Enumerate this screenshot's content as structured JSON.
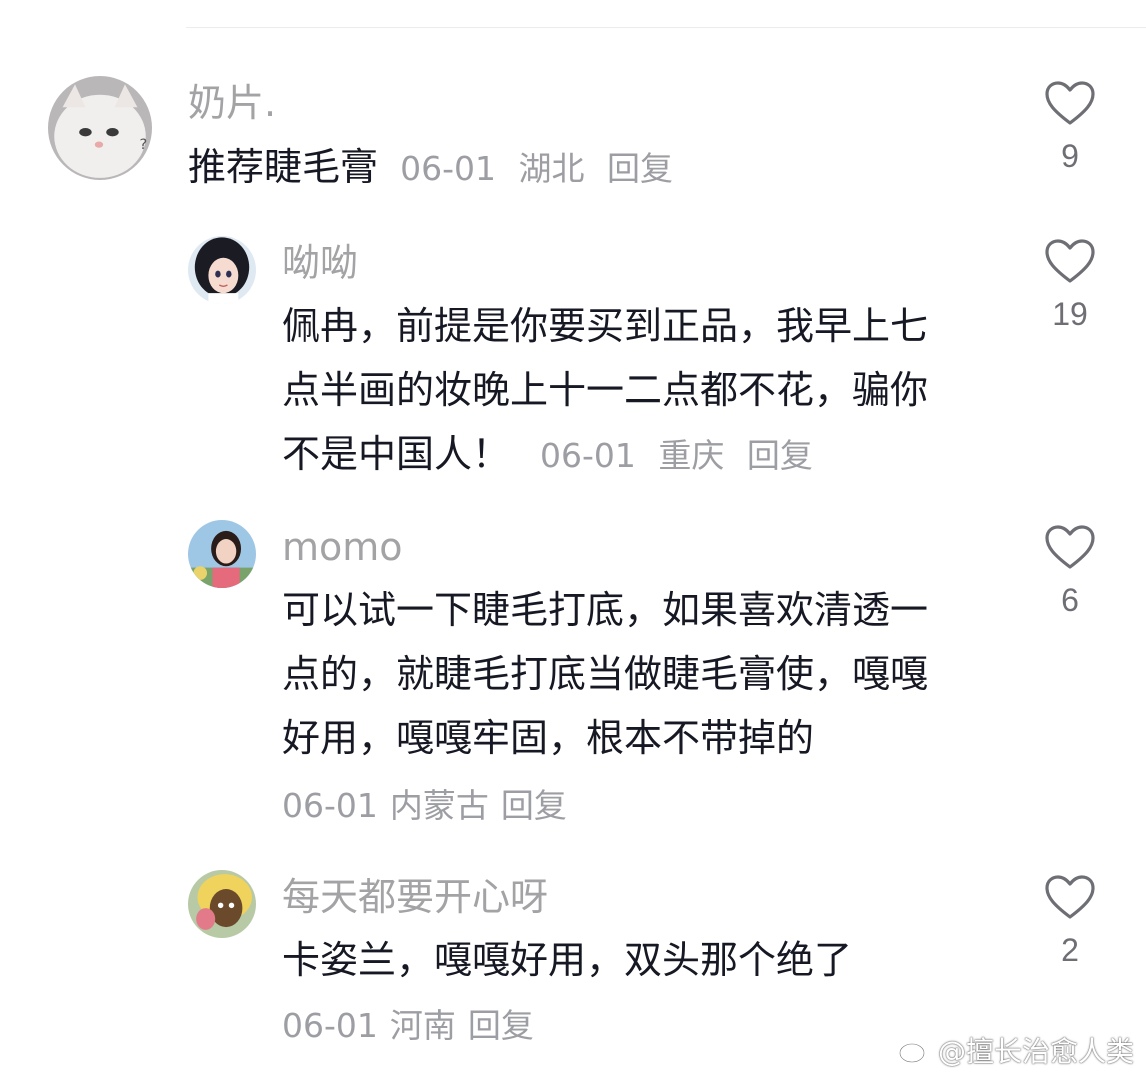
{
  "comments": [
    {
      "username": "奶片.",
      "lines": [
        "推荐睫毛膏"
      ],
      "date": "06-01",
      "location": "湖北",
      "reply_label": "回复",
      "likes": "9",
      "avatar_icon": "white-cat-avatar"
    },
    {
      "username": "呦呦",
      "lines": [
        "佩冉，前提是你要买到正品，我早上七",
        "点半画的妆晚上十一二点都不花，骗你",
        "不是中国人！"
      ],
      "date": "06-01",
      "location": "重庆",
      "reply_label": "回复",
      "likes": "19",
      "avatar_icon": "anime-girl-avatar"
    },
    {
      "username": "momo",
      "lines": [
        "可以试一下睫毛打底，如果喜欢清透一",
        "点的，就睫毛打底当做睫毛膏使，嘎嘎",
        "好用，嘎嘎牢固，根本不带掉的"
      ],
      "date": "06-01",
      "location": "内蒙古",
      "reply_label": "回复",
      "likes": "6",
      "avatar_icon": "woman-photo-avatar"
    },
    {
      "username": "每天都要开心呀",
      "lines": [
        "卡姿兰，嘎嘎好用，双头那个绝了"
      ],
      "date": "06-01",
      "location": "河南",
      "reply_label": "回复",
      "likes": "2",
      "avatar_icon": "cartoon-character-avatar"
    }
  ],
  "watermark": "@擅长治愈人类",
  "colors": {
    "text": "#161823",
    "username": "#a3a3a6",
    "meta": "#9d9ea3",
    "like_count": "#6e6f75"
  }
}
